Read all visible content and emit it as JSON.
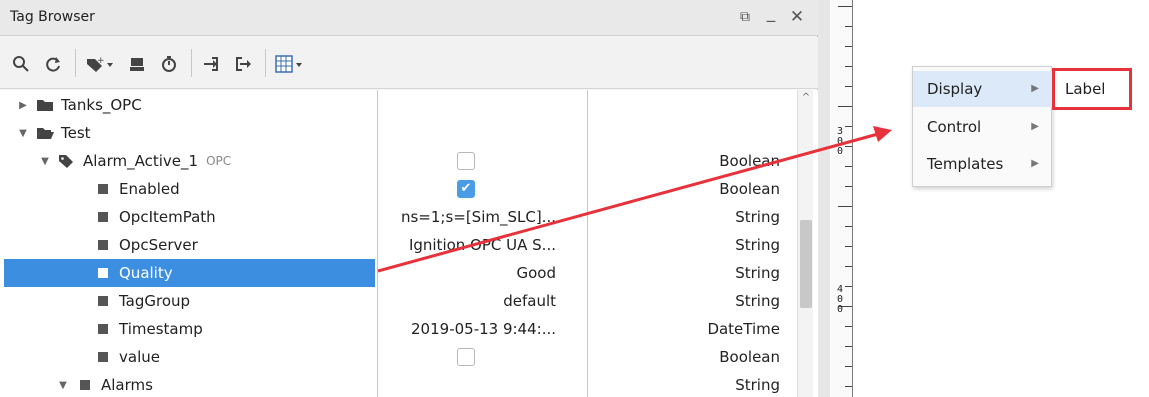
{
  "panel": {
    "title": "Tag Browser",
    "restore_glyph": "⧉",
    "minimize_glyph": "_",
    "close_glyph": "✕"
  },
  "toolbar": {
    "icons": [
      "search-icon",
      "refresh-icon",
      "add-tag-icon",
      "drive-icon",
      "clock-icon",
      "import-icon",
      "export-icon",
      "table-view-icon"
    ]
  },
  "tree": {
    "rows": [
      {
        "name": "Tanks_OPC",
        "value": "",
        "type": "",
        "icon": "folder-icon",
        "caret": "▶",
        "opc": ""
      },
      {
        "name": "Test",
        "value": "",
        "type": "",
        "icon": "folder-open-icon",
        "caret": "▼",
        "opc": ""
      },
      {
        "name": "Alarm_Active_1",
        "value": "",
        "type": "Boolean",
        "icon": "tag-icon",
        "caret": "▼",
        "opc": "OPC",
        "checkbox": "unchecked"
      },
      {
        "name": "Enabled",
        "value": "",
        "type": "Boolean",
        "icon": "property-icon",
        "checkbox": "checked"
      },
      {
        "name": "OpcItemPath",
        "value": "ns=1;s=[Sim_SLC]...",
        "type": "String",
        "icon": "property-icon"
      },
      {
        "name": "OpcServer",
        "value": "Ignition OPC UA S...",
        "type": "String",
        "icon": "property-icon"
      },
      {
        "name": "Quality",
        "value": "Good",
        "type": "String",
        "icon": "property-icon",
        "selected": true
      },
      {
        "name": "TagGroup",
        "value": "default",
        "type": "String",
        "icon": "property-icon"
      },
      {
        "name": "Timestamp",
        "value": "2019-05-13 9:44:...",
        "type": "DateTime",
        "icon": "property-icon"
      },
      {
        "name": "value",
        "value": "",
        "type": "Boolean",
        "icon": "property-icon",
        "checkbox": "unchecked"
      },
      {
        "name": "Alarms",
        "value": "",
        "type": "String",
        "icon": "property-icon",
        "caret": "▼"
      }
    ]
  },
  "ruler": {
    "labels": [
      "3\n0\n0",
      "4\n0\n0"
    ]
  },
  "context_menu": {
    "items": [
      {
        "label": "Display",
        "arrow": "▶"
      },
      {
        "label": "Control",
        "arrow": "▶"
      },
      {
        "label": "Templates",
        "arrow": "▶"
      }
    ],
    "submenu_label": "Label"
  },
  "colors": {
    "selection": "#3b8ee0",
    "annotation_red": "#e8323b",
    "menu_highlight": "#dbe9f8"
  }
}
